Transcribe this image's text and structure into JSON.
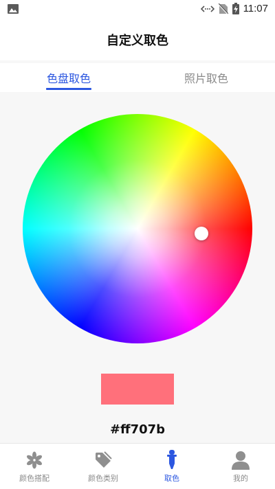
{
  "status_bar": {
    "time": "11:07"
  },
  "header": {
    "title": "自定义取色"
  },
  "tabs": [
    {
      "label": "色盘取色",
      "active": true
    },
    {
      "label": "照片取色",
      "active": false
    }
  ],
  "picker": {
    "selected_color": "#ff707b",
    "hex_label": "#ff707b"
  },
  "colors": {
    "accent": "#2c57e0",
    "inactive": "#8a8a8a"
  },
  "bottom_nav": [
    {
      "label": "颜色搭配",
      "icon": "asterisk-icon"
    },
    {
      "label": "颜色类别",
      "icon": "tag-icon"
    },
    {
      "label": "取色",
      "icon": "dropper-icon",
      "active": true
    },
    {
      "label": "我的",
      "icon": "user-icon"
    }
  ]
}
